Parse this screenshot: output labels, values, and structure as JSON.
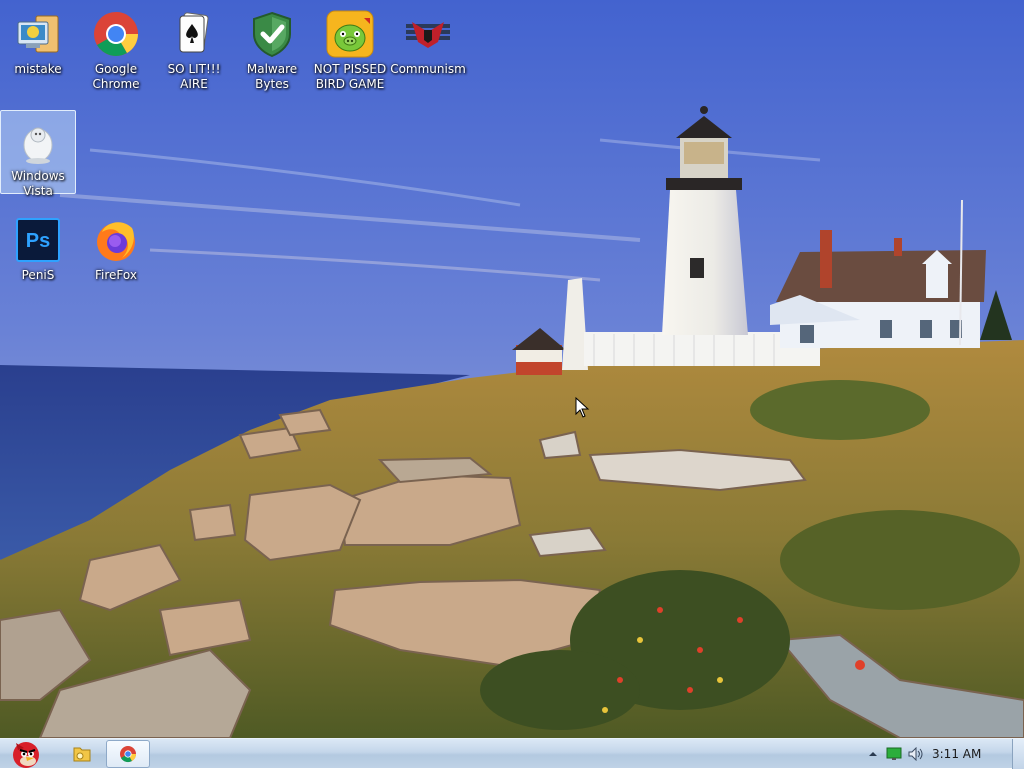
{
  "desktop": {
    "icons": [
      {
        "label": "mistake"
      },
      {
        "label": "Google\nChrome"
      },
      {
        "label": "SO LIT!!! AIRE"
      },
      {
        "label": "Malware\nBytes"
      },
      {
        "label": "NOT PISSED\nBIRD GAME"
      },
      {
        "label": "Communism"
      },
      {
        "label": "Windows\nVista"
      },
      {
        "label": "PeniS"
      },
      {
        "label": "FireFox"
      }
    ]
  },
  "taskbar": {
    "clock": "3:11 AM"
  }
}
